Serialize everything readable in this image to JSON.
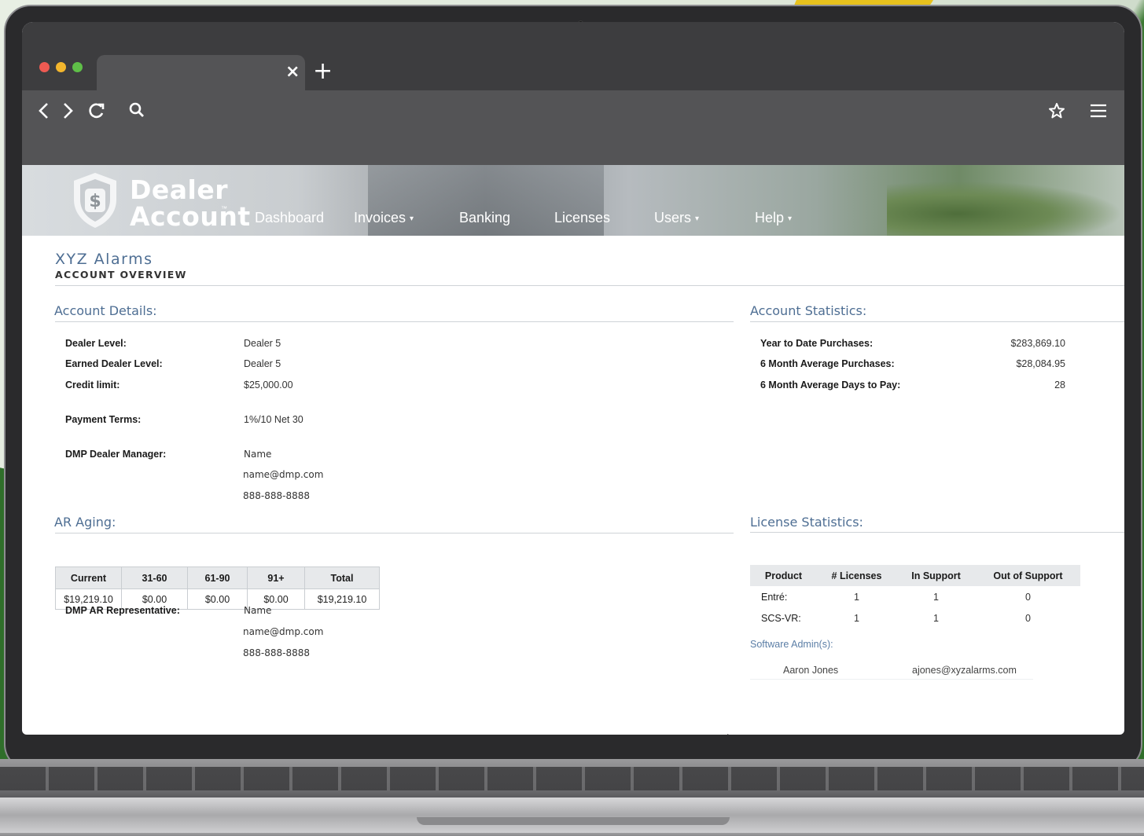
{
  "browser": {
    "tab_close": "×",
    "new_tab": "+",
    "icons": [
      "back-icon",
      "forward-icon",
      "reload-icon",
      "search-icon",
      "bookmark-star-icon",
      "menu-icon"
    ]
  },
  "site": {
    "logo_line1": "Dealer",
    "logo_line2": "Account",
    "logo_tm": "™",
    "nav": [
      {
        "label": "Dashboard",
        "dropdown": false
      },
      {
        "label": "Invoices",
        "dropdown": true
      },
      {
        "label": "Banking",
        "dropdown": false
      },
      {
        "label": "Licenses",
        "dropdown": false
      },
      {
        "label": "Users",
        "dropdown": true
      },
      {
        "label": "Help",
        "dropdown": true
      }
    ],
    "caret": "▾"
  },
  "page": {
    "company": "XYZ Alarms",
    "subtitle": "ACCOUNT OVERVIEW"
  },
  "account_details": {
    "title": "Account Details:",
    "dealer_level_label": "Dealer Level:",
    "dealer_level": "Dealer 5",
    "earned_level_label": "Earned Dealer Level:",
    "earned_level": "Dealer 5",
    "credit_limit_label": "Credit limit:",
    "credit_limit": "$25,000.00",
    "payment_terms_label": "Payment Terms:",
    "payment_terms": "1%/10 Net 30",
    "manager_label": "DMP Dealer Manager:",
    "manager_name": "Name",
    "manager_email": "name@dmp.com",
    "manager_phone": "888-888-8888"
  },
  "account_statistics": {
    "title": "Account Statistics:",
    "ytd_label": "Year to Date Purchases:",
    "ytd": "$283,869.10",
    "avg_purchases_label": "6 Month Average Purchases:",
    "avg_purchases": "$28,084.95",
    "avg_days_label": "6 Month Average Days to Pay:",
    "avg_days": "28"
  },
  "ar_aging": {
    "title": "AR Aging:",
    "headers": [
      "Current",
      "31-60",
      "61-90",
      "91+",
      "Total"
    ],
    "values": [
      "$19,219.10",
      "$0.00",
      "$0.00",
      "$0.00",
      "$19,219.10"
    ],
    "rep_label": "DMP AR Representative:",
    "rep_name": "Name",
    "rep_email": "name@dmp.com",
    "rep_phone": "888-888-8888"
  },
  "license_statistics": {
    "title": "License Statistics:",
    "headers": [
      "Product",
      "# Licenses",
      "In Support",
      "Out of Support"
    ],
    "rows": [
      {
        "product": "Entré:",
        "licenses": "1",
        "in_support": "1",
        "out_support": "0"
      },
      {
        "product": "SCS-VR:",
        "licenses": "1",
        "in_support": "1",
        "out_support": "0"
      }
    ],
    "admins_title": "Software Admin(s):",
    "admin_name": "Aaron Jones",
    "admin_email": "ajones@xyzalarms.com"
  }
}
